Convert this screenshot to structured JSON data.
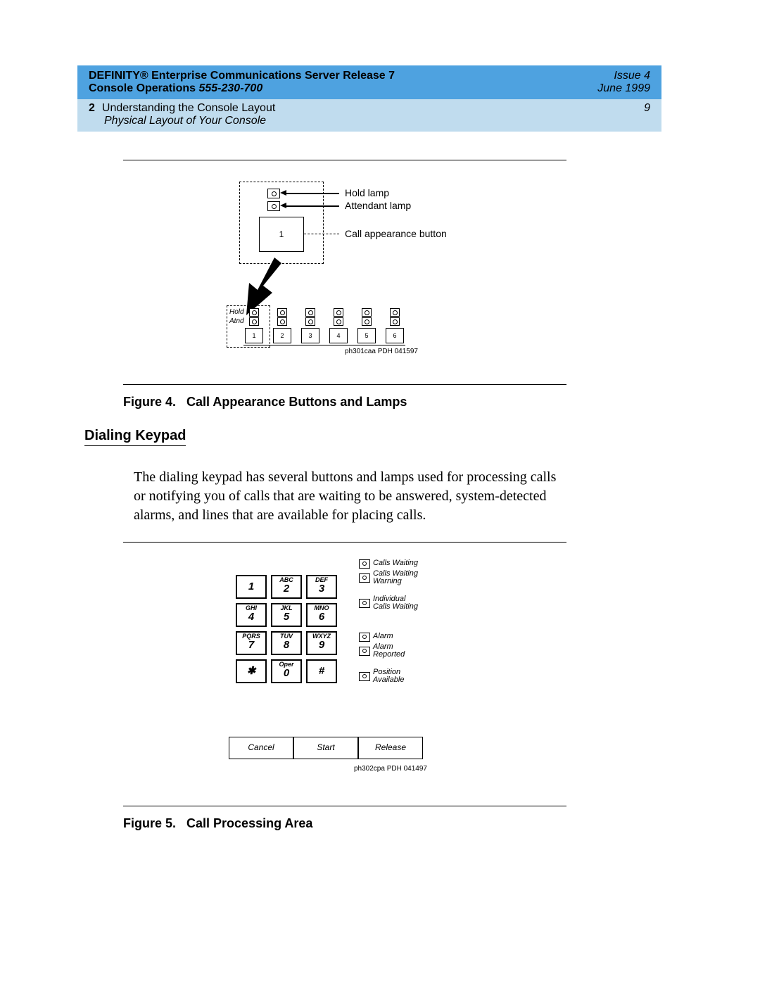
{
  "header": {
    "title_line1": "DEFINITY® Enterprise Communications Server Release 7",
    "title_line2_a": "Console Operations  ",
    "title_line2_b": "555-230-700",
    "issue": "Issue 4",
    "date": "June 1999",
    "section_num": "2",
    "section_title": "Understanding the Console Layout",
    "subsection": "Physical Layout of Your Console",
    "page_num": "9"
  },
  "fig4": {
    "hold_lamp": "Hold lamp",
    "attendant_lamp": "Attendant lamp",
    "ca_button": "Call appearance button",
    "ca_num": "1",
    "strip_hold": "Hold",
    "strip_atnd": "Atnd",
    "nums": [
      "1",
      "2",
      "3",
      "4",
      "5",
      "6"
    ],
    "ref": "ph301caa PDH 041597",
    "caption_label": "Figure 4.",
    "caption_text": "Call Appearance Buttons and Lamps"
  },
  "heading_keypad": "Dialing Keypad",
  "body_text": "The dialing keypad has several buttons and lamps used for processing calls or notifying you of calls that are waiting to be answered, system-detected alarms, and lines that are available for placing calls.",
  "fig5": {
    "keys": [
      {
        "letters": "",
        "num": "1"
      },
      {
        "letters": "ABC",
        "num": "2"
      },
      {
        "letters": "DEF",
        "num": "3"
      },
      {
        "letters": "GHI",
        "num": "4"
      },
      {
        "letters": "JKL",
        "num": "5"
      },
      {
        "letters": "MNO",
        "num": "6"
      },
      {
        "letters": "PQRS",
        "num": "7"
      },
      {
        "letters": "TUV",
        "num": "8"
      },
      {
        "letters": "WXYZ",
        "num": "9"
      },
      {
        "letters": "",
        "num": "✱"
      },
      {
        "letters": "Oper",
        "num": "0"
      },
      {
        "letters": "",
        "num": "#"
      }
    ],
    "status": {
      "calls_waiting": "Calls Waiting",
      "calls_waiting_warning_1": "Calls Waiting",
      "calls_waiting_warning_2": "Warning",
      "individual_1": "Individual",
      "individual_2": "Calls Waiting",
      "alarm": "Alarm",
      "alarm_reported_1": "Alarm",
      "alarm_reported_2": "Reported",
      "position_1": "Position",
      "position_2": "Available"
    },
    "btn_cancel": "Cancel",
    "btn_start": "Start",
    "btn_release": "Release",
    "ref": "ph302cpa PDH 041497",
    "caption_label": "Figure 5.",
    "caption_text": "Call Processing Area"
  }
}
